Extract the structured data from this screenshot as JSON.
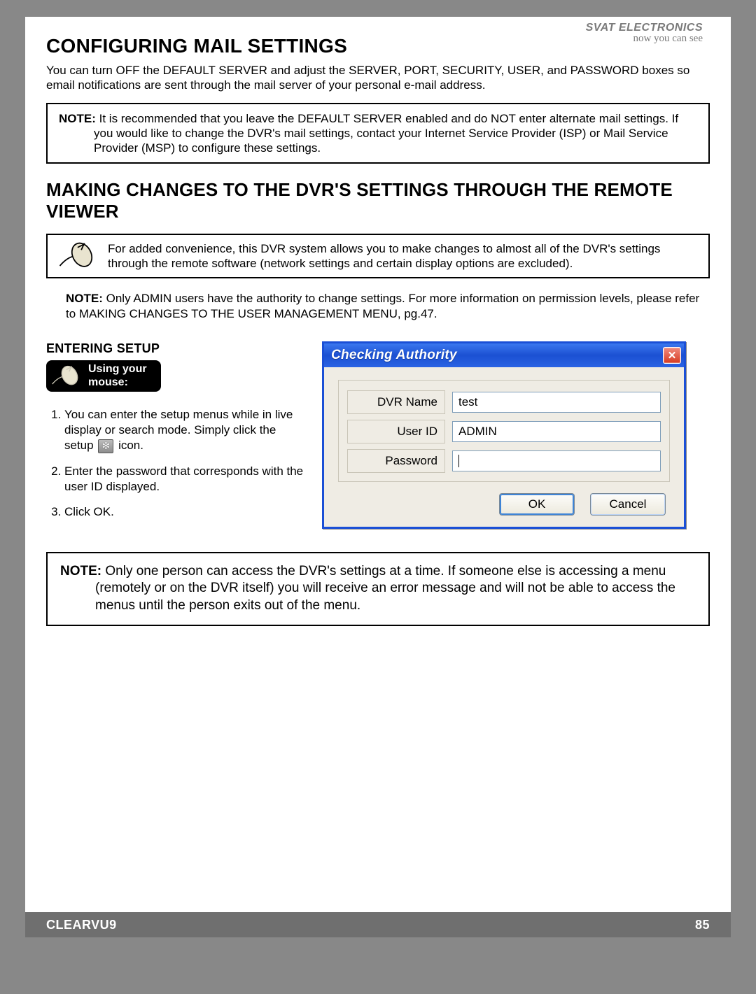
{
  "brand": {
    "line1": "SVAT ELECTRONICS",
    "line2": "now you can see"
  },
  "section1": {
    "title": "CONFIGURING MAIL SETTINGS",
    "intro": "You can turn OFF the DEFAULT SERVER and adjust the SERVER, PORT, SECURITY, USER, and PASSWORD boxes so email notifications are sent through the mail server of your personal e-mail address.",
    "note_label": "NOTE:",
    "note_text": "It is recommended that you leave the DEFAULT SERVER enabled and do NOT enter alternate mail settings.  If you would like to change the DVR's mail settings, contact your Internet Service Provider (ISP) or Mail Service Provider (MSP) to configure these settings."
  },
  "section2": {
    "title": "MAKING CHANGES TO THE DVR'S SETTINGS THROUGH THE REMOTE VIEWER",
    "iconrow_text": "For added convenience, this DVR system allows you to make changes to almost all of the DVR's settings through the remote software (network settings and certain display options are excluded).",
    "note_label": "NOTE:",
    "note_text": "Only ADMIN users have the authority to change settings.  For more information on permission levels, please refer to MAKING CHANGES TO THE USER MANAGEMENT MENU, pg.47."
  },
  "entering": {
    "heading": "ENTERING SETUP",
    "badge_line1": "Using your",
    "badge_line2": "mouse:",
    "steps": {
      "s1a": "You can enter the setup menus while in live display or search mode.  Simply click the setup",
      "s1b": "icon.",
      "s2": "Enter the password that corresponds with the user ID displayed.",
      "s3": "Click OK."
    }
  },
  "dialog": {
    "title": "Checking Authority",
    "labels": {
      "dvr": "DVR Name",
      "user": "User ID",
      "pass": "Password"
    },
    "values": {
      "dvr": "test",
      "user": "ADMIN",
      "pass": ""
    },
    "buttons": {
      "ok": "OK",
      "cancel": "Cancel"
    }
  },
  "note3": {
    "label": "NOTE:",
    "text": "Only one person can access the DVR's settings at a time. If someone else is accessing a menu (remotely or on the DVR itself) you will receive an error message and will not be able to access the menus until the person exits out of the menu."
  },
  "footer": {
    "product": "CLEARVU9",
    "page": "85"
  }
}
